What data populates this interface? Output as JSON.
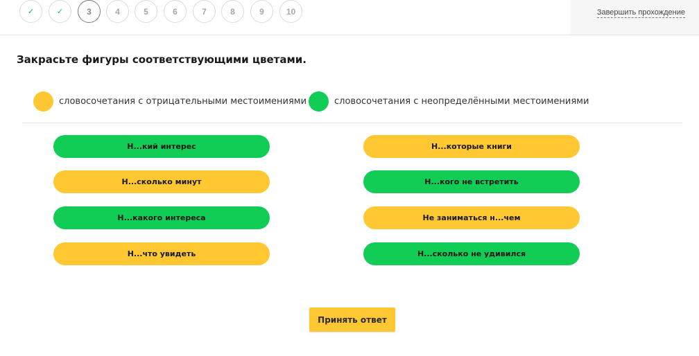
{
  "colors": {
    "green": "#11cc55",
    "yellow": "#ffc833",
    "check_green": "#1bb55c"
  },
  "steps": [
    {
      "label": "✓",
      "state": "done"
    },
    {
      "label": "✓",
      "state": "done"
    },
    {
      "label": "3",
      "state": "current"
    },
    {
      "label": "4",
      "state": "pending"
    },
    {
      "label": "5",
      "state": "pending"
    },
    {
      "label": "6",
      "state": "pending"
    },
    {
      "label": "7",
      "state": "pending"
    },
    {
      "label": "8",
      "state": "pending"
    },
    {
      "label": "9",
      "state": "pending"
    },
    {
      "label": "10",
      "state": "pending"
    }
  ],
  "header": {
    "finish_label": "Завершить прохождение"
  },
  "task": {
    "question": "Закрасьте фигуры соответствующими цветами.",
    "legend": [
      {
        "text": "словосочетания с отрицательными местоимениями",
        "color": "yellow"
      },
      {
        "text": "словосочетания с неопределёнными местоимениями",
        "color": "green"
      }
    ],
    "items": [
      {
        "text": "Н...кий интерес",
        "color": "green"
      },
      {
        "text": "Н...которые книги",
        "color": "yellow"
      },
      {
        "text": "Н...сколько минут",
        "color": "yellow"
      },
      {
        "text": "Н...кого не встретить",
        "color": "green"
      },
      {
        "text": "Н...какого интереса",
        "color": "green"
      },
      {
        "text": "Не заниматься н...чем",
        "color": "yellow"
      },
      {
        "text": "Н...что увидеть",
        "color": "yellow"
      },
      {
        "text": "Н...сколько не удивился",
        "color": "green"
      }
    ]
  },
  "submit_label": "Принять ответ"
}
